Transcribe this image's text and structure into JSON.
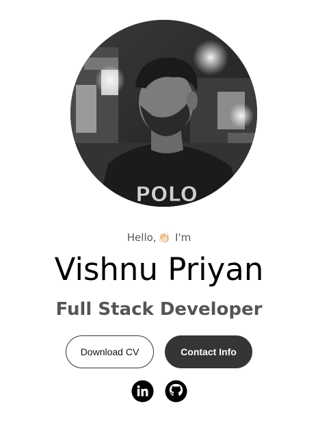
{
  "profile": {
    "photo_alt": "profile-photo"
  },
  "hero": {
    "greeting_prefix": "Hello,",
    "greeting_emoji": "👏🏻",
    "greeting_suffix": "I'm",
    "name": "Vishnu Priyan",
    "role": "Full Stack Developer"
  },
  "actions": {
    "download_label": "Download CV",
    "contact_label": "Contact Info"
  },
  "socials": {
    "items": [
      {
        "icon": "linkedin-icon"
      },
      {
        "icon": "github-icon"
      }
    ]
  },
  "colors": {
    "primary_button_bg": "#353535",
    "text_dark": "#000000",
    "text_muted": "#555555"
  }
}
